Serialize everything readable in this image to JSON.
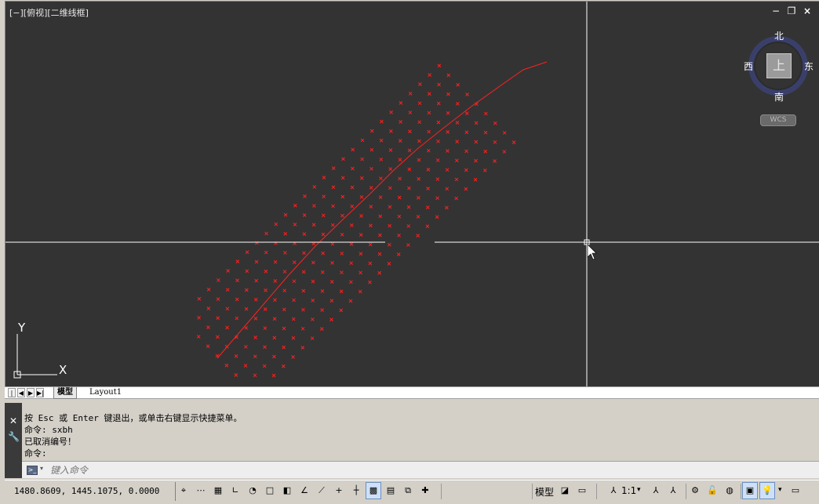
{
  "viewport": {
    "label": "[−][俯视][二维线框]",
    "controls": {
      "minimize": "−",
      "restore": "❐",
      "close": "×"
    }
  },
  "viewcube": {
    "north": "北",
    "south": "南",
    "east": "东",
    "west": "西",
    "face": "上",
    "wcs": "WCS"
  },
  "ucs_icon": {
    "x_label": "X",
    "y_label": "Y"
  },
  "layout_tabs": {
    "nav": [
      "|◀",
      "◀",
      "▶",
      "▶|"
    ],
    "tabs": [
      {
        "label": "模型",
        "active": true
      },
      {
        "label": "Layout1",
        "active": false
      }
    ]
  },
  "command_line": {
    "history": [
      "按 Esc 或 Enter 键退出，或单击右键显示快捷菜单。",
      "命令: sxbh",
      "已取消编号！",
      "命令:"
    ],
    "placeholder": "键入命令",
    "close_icon": "close-icon",
    "settings_icon": "wrench-icon"
  },
  "status_bar": {
    "coordinates": "1480.8609,  1445.1075,  0.0000",
    "model_label": "模型",
    "annotation_scale": "1:1"
  },
  "colors": {
    "canvas": "#333333",
    "points": "#ff2020",
    "crosshair": "#ffffff",
    "viewcube_ring": "#3a3f6a"
  }
}
